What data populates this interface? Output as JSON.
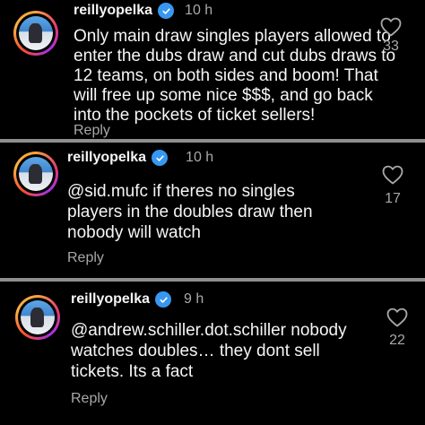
{
  "comments": [
    {
      "username": "reillyopelka",
      "time": "10 h",
      "lines": [
        "Only main draw singles players allowed to",
        "enter the dubs draw and cut dubs draws to",
        "12 teams, on both sides and boom! That",
        "will free up some nice $$$, and go back",
        "into the pockets of ticket sellers!"
      ],
      "reply_label": "Reply",
      "likes": "33"
    },
    {
      "username": "reillyopelka",
      "time": "10 h",
      "lines": [
        "@sid.mufc if theres no singles",
        "players in the doubles draw then",
        "nobody will watch"
      ],
      "reply_label": "Reply",
      "likes": "17"
    },
    {
      "username": "reillyopelka",
      "time": "9 h",
      "lines": [
        "@andrew.schiller.dot.schiller nobody",
        "watches doubles… they dont sell",
        "tickets. Its a fact"
      ],
      "reply_label": "Reply",
      "likes": "22"
    }
  ],
  "colors": {
    "background": "#000000",
    "text": "#f5f5f5",
    "muted": "#a8a8a8",
    "verified": "#3897f0",
    "separator": "#8e8e8e"
  },
  "icons": {
    "verified": "verified-badge-icon",
    "like": "heart-outline-icon"
  }
}
